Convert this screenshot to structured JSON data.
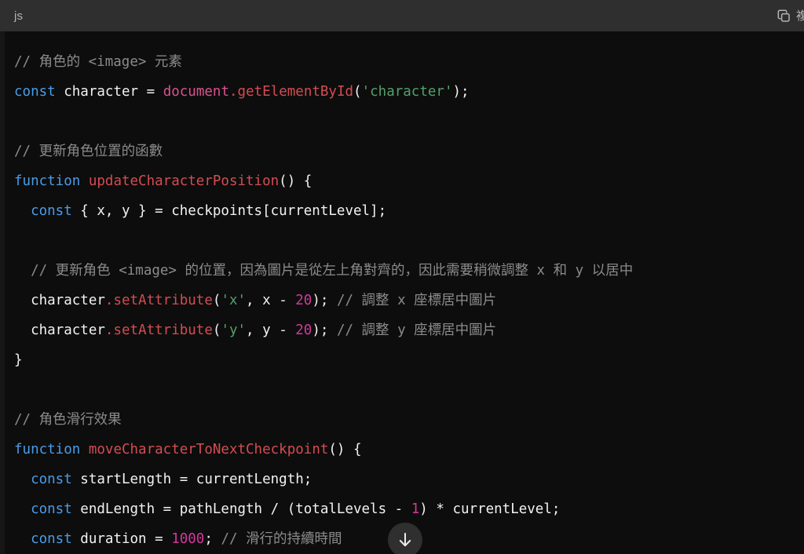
{
  "header": {
    "language_label": "js",
    "copy_icon": "copy-icon",
    "copy_label": "複製"
  },
  "scroll_button": {
    "icon": "arrow-down-icon"
  },
  "code": {
    "language": "javascript",
    "lines": [
      {
        "id": 1,
        "tokens": [
          {
            "t": "// 角色的 <image> 元素",
            "c": "t-com"
          }
        ]
      },
      {
        "id": 2,
        "tokens": [
          {
            "t": "const",
            "c": "t-kw"
          },
          {
            "t": " character ",
            "c": "t-pln"
          },
          {
            "t": "=",
            "c": "t-pln"
          },
          {
            "t": " ",
            "c": "t-pln"
          },
          {
            "t": "document",
            "c": "t-prop"
          },
          {
            "t": ".",
            "c": "t-fn"
          },
          {
            "t": "getElementById",
            "c": "t-fn"
          },
          {
            "t": "(",
            "c": "t-pln"
          },
          {
            "t": "'character'",
            "c": "t-str"
          },
          {
            "t": ");",
            "c": "t-pln"
          }
        ]
      },
      {
        "id": 3,
        "tokens": []
      },
      {
        "id": 4,
        "tokens": [
          {
            "t": "// 更新角色位置的函數",
            "c": "t-com"
          }
        ]
      },
      {
        "id": 5,
        "tokens": [
          {
            "t": "function",
            "c": "t-kw"
          },
          {
            "t": " ",
            "c": "t-pln"
          },
          {
            "t": "updateCharacterPosition",
            "c": "t-fn"
          },
          {
            "t": "() {",
            "c": "t-pln"
          }
        ]
      },
      {
        "id": 6,
        "tokens": [
          {
            "t": "  ",
            "c": "t-pln"
          },
          {
            "t": "const",
            "c": "t-kw"
          },
          {
            "t": " { x, y } = checkpoints[currentLevel];",
            "c": "t-pln"
          }
        ]
      },
      {
        "id": 7,
        "tokens": []
      },
      {
        "id": 8,
        "tokens": [
          {
            "t": "  // 更新角色 <image> 的位置，因為圖片是從左上角對齊的，因此需要稍微調整 x 和 y 以居中",
            "c": "t-com"
          }
        ]
      },
      {
        "id": 9,
        "tokens": [
          {
            "t": "  character",
            "c": "t-pln"
          },
          {
            "t": ".",
            "c": "t-fn"
          },
          {
            "t": "setAttribute",
            "c": "t-fn"
          },
          {
            "t": "(",
            "c": "t-pln"
          },
          {
            "t": "'x'",
            "c": "t-str"
          },
          {
            "t": ", x - ",
            "c": "t-pln"
          },
          {
            "t": "20",
            "c": "t-num"
          },
          {
            "t": "); ",
            "c": "t-pln"
          },
          {
            "t": "// 調整 x 座標居中圖片",
            "c": "t-com"
          }
        ]
      },
      {
        "id": 10,
        "tokens": [
          {
            "t": "  character",
            "c": "t-pln"
          },
          {
            "t": ".",
            "c": "t-fn"
          },
          {
            "t": "setAttribute",
            "c": "t-fn"
          },
          {
            "t": "(",
            "c": "t-pln"
          },
          {
            "t": "'y'",
            "c": "t-str"
          },
          {
            "t": ", y - ",
            "c": "t-pln"
          },
          {
            "t": "20",
            "c": "t-num"
          },
          {
            "t": "); ",
            "c": "t-pln"
          },
          {
            "t": "// 調整 y 座標居中圖片",
            "c": "t-com"
          }
        ]
      },
      {
        "id": 11,
        "tokens": [
          {
            "t": "}",
            "c": "t-pln"
          }
        ]
      },
      {
        "id": 12,
        "tokens": []
      },
      {
        "id": 13,
        "tokens": [
          {
            "t": "// 角色滑行效果",
            "c": "t-com"
          }
        ]
      },
      {
        "id": 14,
        "tokens": [
          {
            "t": "function",
            "c": "t-kw"
          },
          {
            "t": " ",
            "c": "t-pln"
          },
          {
            "t": "moveCharacterToNextCheckpoint",
            "c": "t-fn"
          },
          {
            "t": "() {",
            "c": "t-pln"
          }
        ]
      },
      {
        "id": 15,
        "tokens": [
          {
            "t": "  ",
            "c": "t-pln"
          },
          {
            "t": "const",
            "c": "t-kw"
          },
          {
            "t": " startLength = currentLength;",
            "c": "t-pln"
          }
        ]
      },
      {
        "id": 16,
        "tokens": [
          {
            "t": "  ",
            "c": "t-pln"
          },
          {
            "t": "const",
            "c": "t-kw"
          },
          {
            "t": " endLength = pathLength / (totalLevels - ",
            "c": "t-pln"
          },
          {
            "t": "1",
            "c": "t-num"
          },
          {
            "t": ") * currentLevel;",
            "c": "t-pln"
          }
        ]
      },
      {
        "id": 17,
        "tokens": [
          {
            "t": "  ",
            "c": "t-pln"
          },
          {
            "t": "const",
            "c": "t-kw"
          },
          {
            "t": " duration = ",
            "c": "t-pln"
          },
          {
            "t": "1000",
            "c": "t-num"
          },
          {
            "t": "; ",
            "c": "t-pln"
          },
          {
            "t": "// 滑行的持續時間",
            "c": "t-com"
          }
        ]
      }
    ]
  }
}
